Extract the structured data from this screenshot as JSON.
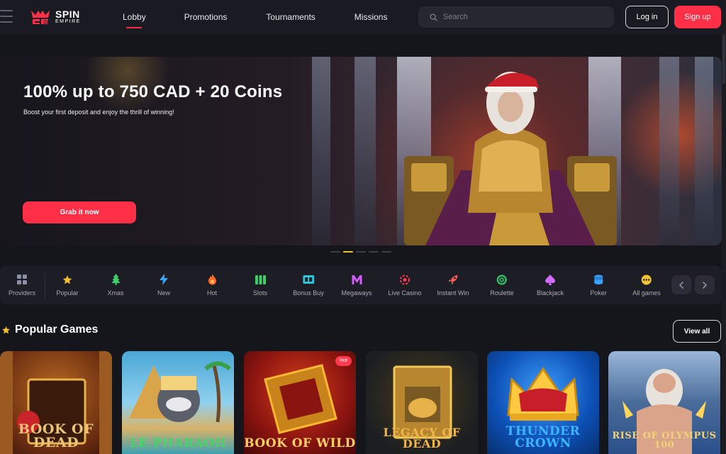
{
  "header": {
    "logo": {
      "line1": "SPIN",
      "line2": "EMPIRE"
    },
    "nav": [
      {
        "label": "Lobby",
        "active": true
      },
      {
        "label": "Promotions",
        "active": false
      },
      {
        "label": "Tournaments",
        "active": false
      },
      {
        "label": "Missions",
        "active": false
      }
    ],
    "search_placeholder": "Search",
    "login_label": "Log in",
    "signup_label": "Sign up"
  },
  "hero": {
    "title": "100% up to 750 CAD + 20 Coins",
    "subtitle": "Boost your first deposit and enjoy the thrill of winning!",
    "cta_label": "Grab it now",
    "slides": 5,
    "active_slide": 2
  },
  "categories": [
    {
      "label": "Providers",
      "icon": "grid-icon",
      "color": "#8c90a6"
    },
    {
      "label": "Popular",
      "icon": "star-icon",
      "color": "#f2c230"
    },
    {
      "label": "Xmas",
      "icon": "xmas-tree-icon",
      "color": "#3ecf6a"
    },
    {
      "label": "New",
      "icon": "lightning-icon",
      "color": "#3aa3ff"
    },
    {
      "label": "Hot",
      "icon": "flame-icon",
      "color": "#ff6a2b"
    },
    {
      "label": "Slots",
      "icon": "slots-icon",
      "color": "#39d168"
    },
    {
      "label": "Bonus Buy",
      "icon": "bonus-buy-icon",
      "color": "#2ec5d8"
    },
    {
      "label": "Megaways",
      "icon": "megaways-icon",
      "color": "#d45bff"
    },
    {
      "label": "Live Casino",
      "icon": "live-casino-icon",
      "color": "#ff3b50"
    },
    {
      "label": "Instant Win",
      "icon": "rocket-icon",
      "color": "#ff5a5a"
    },
    {
      "label": "Roulette",
      "icon": "roulette-icon",
      "color": "#33c26a"
    },
    {
      "label": "Blackjack",
      "icon": "spade-icon",
      "color": "#d46bff"
    },
    {
      "label": "Poker",
      "icon": "chips-icon",
      "color": "#3aa3ff"
    },
    {
      "label": "All games",
      "icon": "more-icon",
      "color": "#f2c230"
    }
  ],
  "popular": {
    "title": "Popular Games",
    "view_all_label": "View all",
    "badge_hot": "Hot",
    "games": [
      {
        "title": "BOOK OF DEAD",
        "bg": "#7a3a14",
        "accent": "#e8b24a",
        "text_color": "#e9c57a"
      },
      {
        "title": "LE PHARAOH",
        "bg": "#4aa7d6",
        "accent": "#f2d27a",
        "text_color": "#46d36b"
      },
      {
        "title": "BOOK OF WILD",
        "bg": "#8a1410",
        "accent": "#ffb833",
        "text_color": "#ffd166",
        "hot": true
      },
      {
        "title": "LEGACY OF DEAD",
        "bg": "#1c1f22",
        "accent": "#e8b24a",
        "text_color": "#f0b64a"
      },
      {
        "title": "THUNDER CROWN",
        "bg": "#0c4fb5",
        "accent": "#ffc940",
        "text_color": "#3fb5ff"
      },
      {
        "title": "RISE OF OLYMPUS 100",
        "bg": "#2b4f8a",
        "accent": "#d6c08a",
        "text_color": "#f2d27a"
      }
    ]
  }
}
